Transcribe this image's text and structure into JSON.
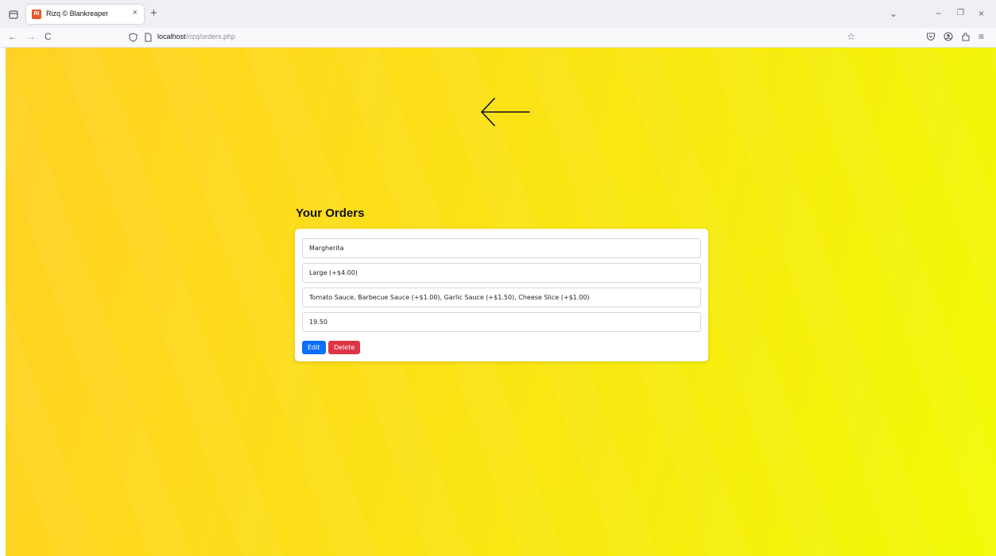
{
  "browser": {
    "tab": {
      "favicon_text": "RI",
      "title": "Rizq © Blankreaper",
      "close": "×"
    },
    "new_tab": "+",
    "window_controls": {
      "list_all": "⌄",
      "minimize": "−",
      "restore": "❐",
      "close": "×"
    },
    "nav": {
      "back": "←",
      "forward": "→",
      "reload": "C"
    },
    "url": {
      "host": "localhost",
      "path": "/rizq/orders.php"
    },
    "bookmark": "☆",
    "menu": "≡"
  },
  "page": {
    "heading": "Your Orders",
    "orders": [
      {
        "pizza": "Margherita",
        "size": "Large (+$4.00)",
        "toppings": "Tomato Sauce, Barbecue Sauce (+$1.00), Garlic Sauce (+$1.50), Cheese Slice (+$1.00)",
        "total": "19.50",
        "edit_label": "Edit",
        "delete_label": "Delete"
      }
    ]
  },
  "colors": {
    "gradient_start": "#ffd124",
    "gradient_end": "#f2fb06",
    "edit_button": "#0d6efd",
    "delete_button": "#dc3545"
  }
}
